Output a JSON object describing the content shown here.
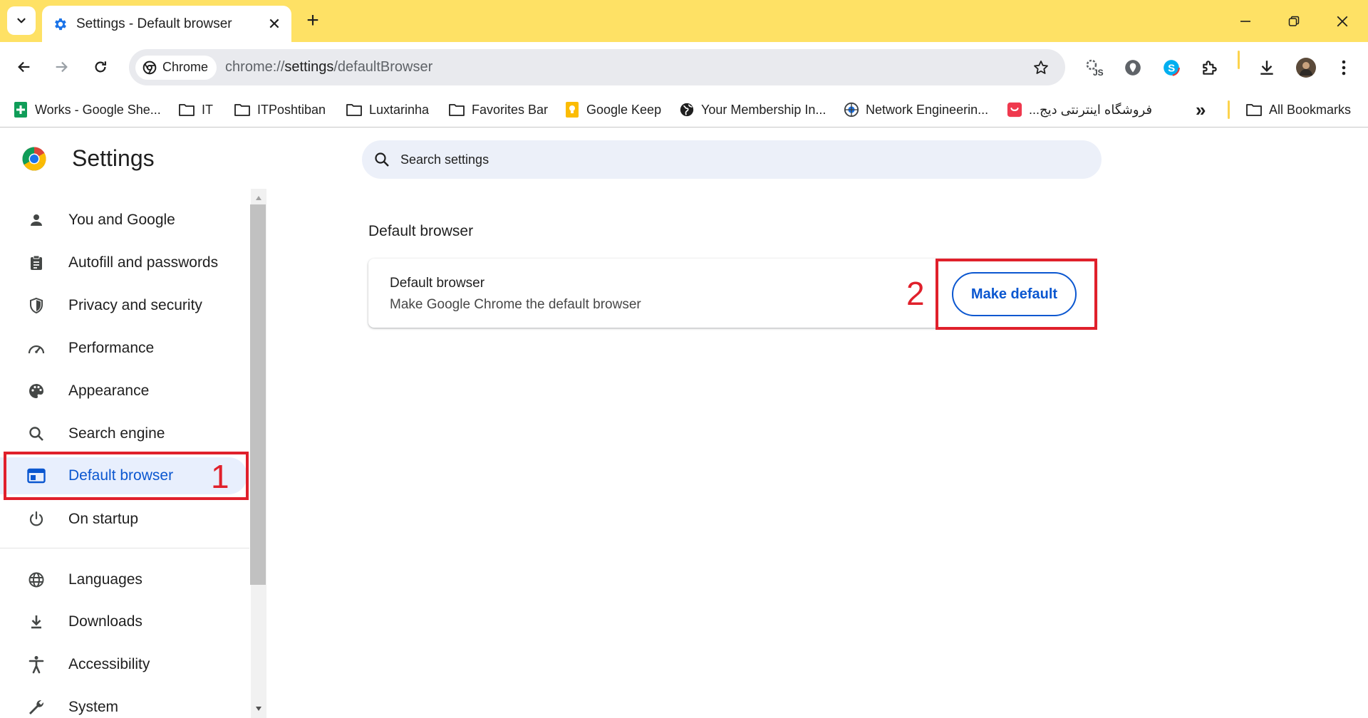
{
  "colors": {
    "titlebar": "#fee165",
    "accent": "#0b57d0",
    "annotation": "#e0202b",
    "active_nav_bg": "#e8effd"
  },
  "tab": {
    "title": "Settings - Default browser",
    "icon": "gear-icon",
    "close": "✕"
  },
  "new_tab": "+",
  "window_controls": {
    "minimize": "minimize-icon",
    "restore": "restore-icon",
    "close": "close-icon"
  },
  "toolbar": {
    "chip_label": "Chrome",
    "url_scheme": "chrome://",
    "url_host": "settings",
    "url_path": "/defaultBrowser"
  },
  "bookmarks": [
    {
      "label": "Works - Google She...",
      "icon": "sheets-icon"
    },
    {
      "label": "IT",
      "icon": "folder-icon"
    },
    {
      "label": "ITPoshtiban",
      "icon": "folder-icon"
    },
    {
      "label": "Luxtarinha",
      "icon": "folder-icon"
    },
    {
      "label": "Favorites Bar",
      "icon": "folder-icon"
    },
    {
      "label": "Google Keep",
      "icon": "keep-icon"
    },
    {
      "label": "Your Membership In...",
      "icon": "globe-icon"
    },
    {
      "label": "Network Engineerin...",
      "icon": "network-icon"
    },
    {
      "label": "فروشگاه اینترنتی دیج...",
      "icon": "digikala-icon"
    }
  ],
  "bookmarks_overflow": "»",
  "all_bookmarks": "All Bookmarks",
  "settings_title": "Settings",
  "sidebar": [
    {
      "label": "You and Google",
      "icon": "person-icon"
    },
    {
      "label": "Autofill and passwords",
      "icon": "clipboard-icon"
    },
    {
      "label": "Privacy and security",
      "icon": "shield-icon"
    },
    {
      "label": "Performance",
      "icon": "speedometer-icon"
    },
    {
      "label": "Appearance",
      "icon": "palette-icon"
    },
    {
      "label": "Search engine",
      "icon": "search-icon"
    },
    {
      "label": "Default browser",
      "icon": "browser-icon",
      "active": true
    },
    {
      "label": "On startup",
      "icon": "power-icon"
    },
    {
      "label": "Languages",
      "icon": "globe-icon"
    },
    {
      "label": "Downloads",
      "icon": "download-icon"
    },
    {
      "label": "Accessibility",
      "icon": "accessibility-icon"
    },
    {
      "label": "System",
      "icon": "wrench-icon"
    }
  ],
  "search": {
    "placeholder": "Search settings"
  },
  "main": {
    "section_heading": "Default browser",
    "card_title": "Default browser",
    "card_subtitle": "Make Google Chrome the default browser",
    "button_label": "Make default"
  },
  "annotations": {
    "one": "1",
    "two": "2"
  }
}
